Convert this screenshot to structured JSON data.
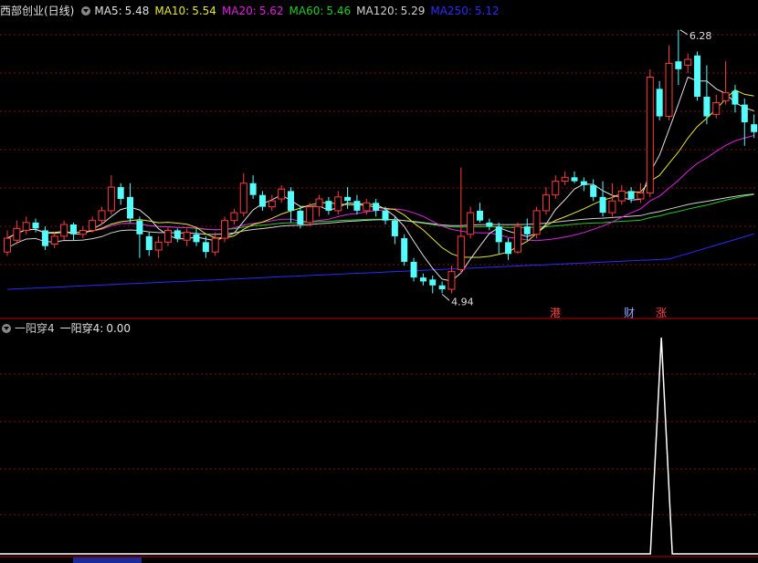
{
  "header": {
    "title": "西部创业(日线)",
    "ma": [
      {
        "label": "MA5:",
        "value": "5.48",
        "color": "#e0e0e0"
      },
      {
        "label": "MA10:",
        "value": "5.54",
        "color": "#e6e62e"
      },
      {
        "label": "MA20:",
        "value": "5.62",
        "color": "#e020e0"
      },
      {
        "label": "MA60:",
        "value": "5.46",
        "color": "#22cc22"
      },
      {
        "label": "MA120:",
        "value": "5.29",
        "color": "#d0d0d0"
      },
      {
        "label": "MA250:",
        "value": "5.12",
        "color": "#2a2aff"
      }
    ]
  },
  "indicator": {
    "name": "一阳穿4",
    "label": "一阳穿4:",
    "value": "0.00"
  },
  "annotations": {
    "high_label": "6.28",
    "low_label": "4.94"
  },
  "events": [
    {
      "text": "港",
      "color": "#ff4444"
    },
    {
      "text": "财",
      "color": "#8ea8ff"
    },
    {
      "text": "涨",
      "color": "#ff4444"
    }
  ],
  "colors": {
    "up": "#ff3b3b",
    "down": "#54fcfc",
    "grid": "#7a1010",
    "divider": "#c00000"
  },
  "chart_data": {
    "type": "candlestick",
    "candles": [
      [
        5.15,
        5.22,
        5.26,
        5.13
      ],
      [
        5.21,
        5.27,
        5.31,
        5.19
      ],
      [
        5.26,
        5.3,
        5.33,
        5.24
      ],
      [
        5.3,
        5.27,
        5.32,
        5.25
      ],
      [
        5.26,
        5.18,
        5.28,
        5.16
      ],
      [
        5.19,
        5.23,
        5.25,
        5.17
      ],
      [
        5.23,
        5.29,
        5.31,
        5.21
      ],
      [
        5.29,
        5.24,
        5.3,
        5.21
      ],
      [
        5.24,
        5.26,
        5.28,
        5.22
      ],
      [
        5.26,
        5.31,
        5.33,
        5.25
      ],
      [
        5.31,
        5.36,
        5.38,
        5.29
      ],
      [
        5.36,
        5.48,
        5.54,
        5.34
      ],
      [
        5.48,
        5.42,
        5.5,
        5.39
      ],
      [
        5.43,
        5.32,
        5.5,
        5.3
      ],
      [
        5.31,
        5.24,
        5.33,
        5.12
      ],
      [
        5.23,
        5.16,
        5.25,
        5.13
      ],
      [
        5.16,
        5.2,
        5.23,
        5.12
      ],
      [
        5.2,
        5.26,
        5.28,
        5.18
      ],
      [
        5.26,
        5.22,
        5.27,
        5.2
      ],
      [
        5.21,
        5.25,
        5.27,
        5.18
      ],
      [
        5.24,
        5.2,
        5.27,
        5.18
      ],
      [
        5.2,
        5.15,
        5.23,
        5.12
      ],
      [
        5.15,
        5.22,
        5.25,
        5.13
      ],
      [
        5.22,
        5.31,
        5.33,
        5.2
      ],
      [
        5.31,
        5.35,
        5.37,
        5.29
      ],
      [
        5.35,
        5.5,
        5.55,
        5.33
      ],
      [
        5.5,
        5.44,
        5.54,
        5.42
      ],
      [
        5.44,
        5.38,
        5.46,
        5.36
      ],
      [
        5.38,
        5.41,
        5.44,
        5.36
      ],
      [
        5.42,
        5.47,
        5.49,
        5.4
      ],
      [
        5.46,
        5.36,
        5.48,
        5.3
      ],
      [
        5.36,
        5.29,
        5.38,
        5.27
      ],
      [
        5.3,
        5.38,
        5.4,
        5.28
      ],
      [
        5.38,
        5.42,
        5.44,
        5.33
      ],
      [
        5.41,
        5.36,
        5.43,
        5.34
      ],
      [
        5.36,
        5.43,
        5.46,
        5.34
      ],
      [
        5.43,
        5.41,
        5.48,
        5.37
      ],
      [
        5.41,
        5.36,
        5.44,
        5.34
      ],
      [
        5.36,
        5.4,
        5.42,
        5.34
      ],
      [
        5.4,
        5.36,
        5.42,
        5.33
      ],
      [
        5.36,
        5.31,
        5.38,
        5.29
      ],
      [
        5.31,
        5.23,
        5.33,
        5.19
      ],
      [
        5.22,
        5.1,
        5.24,
        5.08
      ],
      [
        5.1,
        5.02,
        5.12,
        5.0
      ],
      [
        5.02,
        5.0,
        5.04,
        4.98
      ],
      [
        5.01,
        4.98,
        5.03,
        4.94
      ],
      [
        4.98,
        4.96,
        5.0,
        4.94
      ],
      [
        4.96,
        5.05,
        5.08,
        4.94
      ],
      [
        5.06,
        5.23,
        5.58,
        5.04
      ],
      [
        5.24,
        5.35,
        5.38,
        5.22
      ],
      [
        5.36,
        5.31,
        5.4,
        5.3
      ],
      [
        5.3,
        5.28,
        5.32,
        5.26
      ],
      [
        5.28,
        5.2,
        5.3,
        5.14
      ],
      [
        5.2,
        5.14,
        5.22,
        5.11
      ],
      [
        5.15,
        5.28,
        5.3,
        5.14
      ],
      [
        5.28,
        5.24,
        5.32,
        5.21
      ],
      [
        5.24,
        5.36,
        5.38,
        5.22
      ],
      [
        5.36,
        5.44,
        5.48,
        5.34
      ],
      [
        5.44,
        5.51,
        5.54,
        5.42
      ],
      [
        5.51,
        5.53,
        5.56,
        5.49
      ],
      [
        5.53,
        5.51,
        5.56,
        5.5
      ],
      [
        5.51,
        5.49,
        5.53,
        5.46
      ],
      [
        5.49,
        5.43,
        5.52,
        5.41
      ],
      [
        5.43,
        5.35,
        5.51,
        5.33
      ],
      [
        5.35,
        5.41,
        5.5,
        5.33
      ],
      [
        5.41,
        5.46,
        5.49,
        5.39
      ],
      [
        5.46,
        5.42,
        5.48,
        5.4
      ],
      [
        5.42,
        5.45,
        5.5,
        5.4
      ],
      [
        5.45,
        6.04,
        6.08,
        5.43
      ],
      [
        5.98,
        5.84,
        6.02,
        5.82
      ],
      [
        5.84,
        6.11,
        6.2,
        5.82
      ],
      [
        6.12,
        6.08,
        6.28,
        6.0
      ],
      [
        6.1,
        6.13,
        6.16,
        6.06
      ],
      [
        6.15,
        5.94,
        6.17,
        5.92
      ],
      [
        5.94,
        5.84,
        6.1,
        5.8
      ],
      [
        5.85,
        5.91,
        5.95,
        5.83
      ],
      [
        5.92,
        5.96,
        6.12,
        5.9
      ],
      [
        5.97,
        5.9,
        6.0,
        5.86
      ],
      [
        5.9,
        5.81,
        5.93,
        5.69
      ],
      [
        5.8,
        5.76,
        5.85,
        5.73
      ]
    ],
    "price_range": [
      4.9,
      6.33
    ],
    "indicator_series": {
      "name": "一阳穿4",
      "signal_index": 69,
      "values": "0 everywhere except signal_index = 1",
      "range": [
        0,
        1
      ]
    }
  }
}
